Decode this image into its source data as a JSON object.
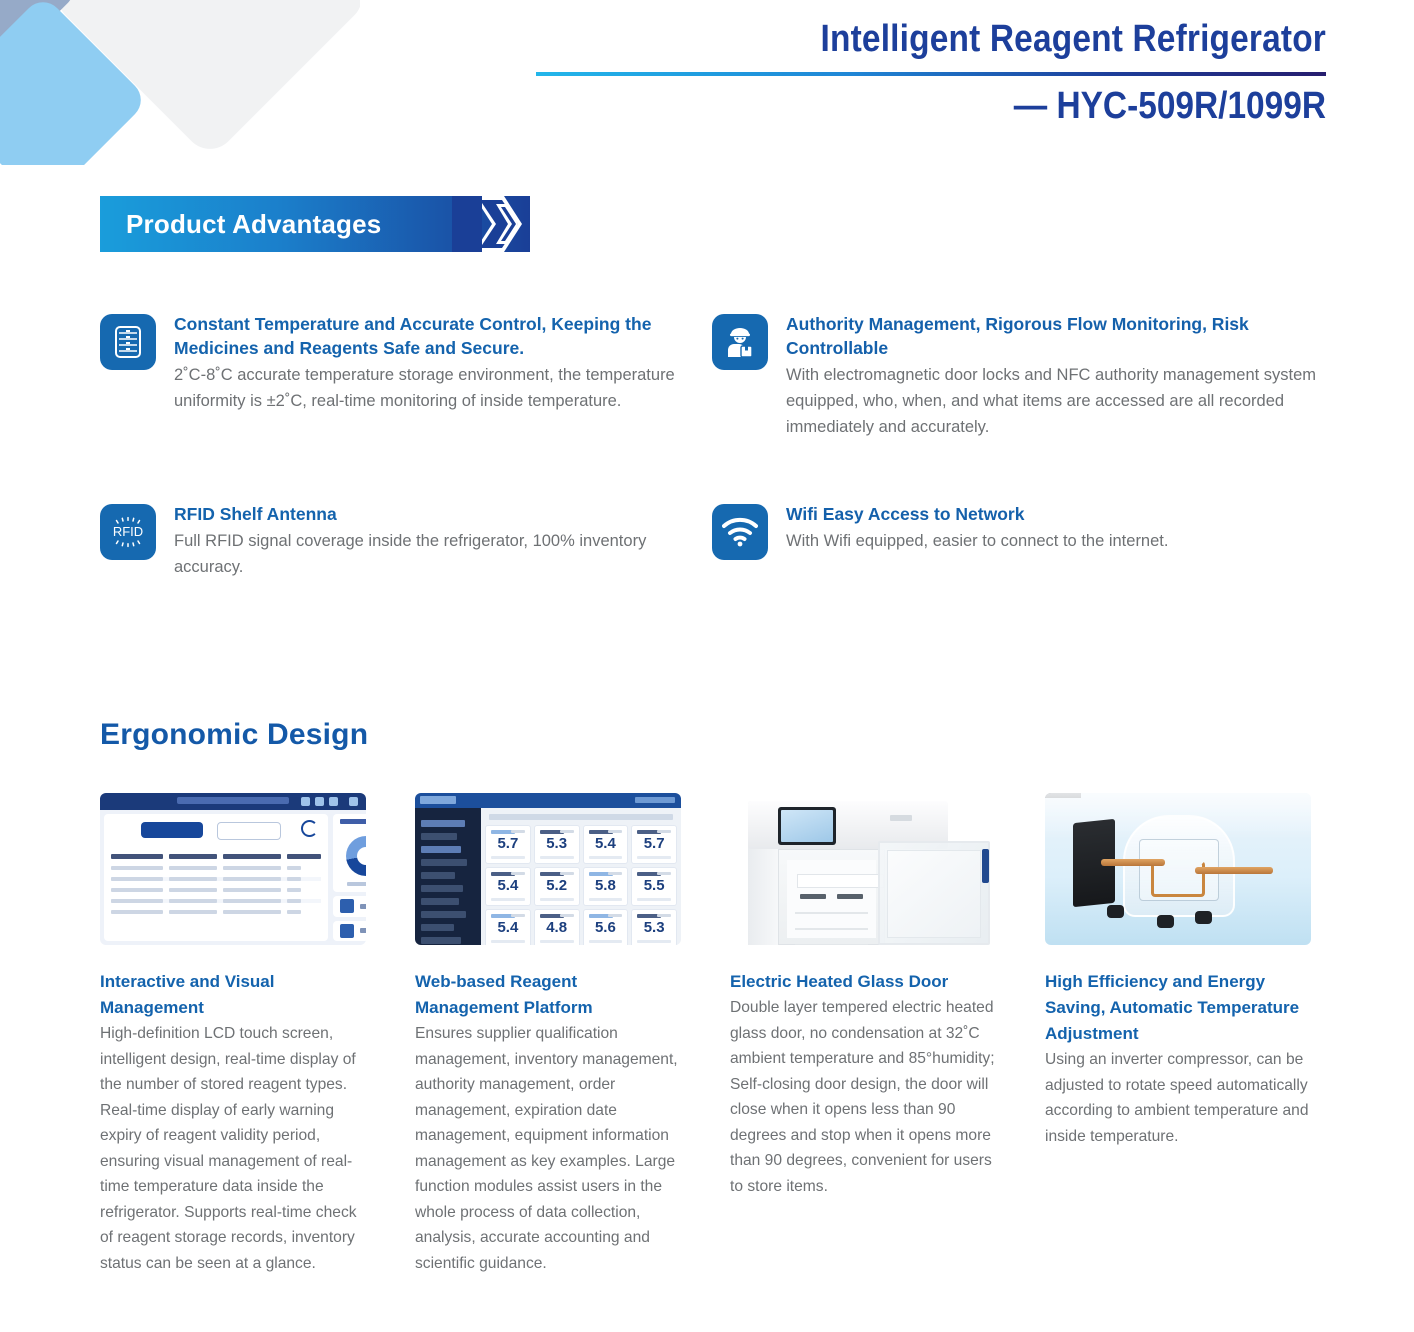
{
  "header": {
    "title": "Intelligent Reagent Refrigerator",
    "model": "— HYC-509R/1099R"
  },
  "banner": {
    "label": "Product Advantages",
    "chevron_icon": "chevron-right-icon",
    "gradient_from": "#1a9ddb",
    "gradient_to": "#1a3f97"
  },
  "features": [
    {
      "icon": "shelf-rack-icon",
      "title": "Constant Temperature and Accurate Control, Keeping the Medicines and Reagents Safe and Secure.",
      "desc": "2˚C-8˚C accurate temperature storage environment, the temperature uniformity is ±2˚C, real-time monitoring of inside temperature."
    },
    {
      "icon": "authority-person-badge-icon",
      "title": "Authority Management, Rigorous Flow Monitoring, Risk Controllable",
      "desc": "With electromagnetic door locks and NFC authority management system equipped, who, when, and what items are accessed are all recorded immediately and accurately."
    },
    {
      "icon": "rfid-icon",
      "title": "RFID Shelf Antenna",
      "desc": "Full RFID signal coverage inside the refrigerator, 100% inventory accuracy."
    },
    {
      "icon": "wifi-icon",
      "title": "Wifi Easy Access to Network",
      "desc": "With Wifi equipped, easier to connect to the internet."
    }
  ],
  "rfid_icon_label": "RFID",
  "ergonomic": {
    "section_title": "Ergonomic Design",
    "cards": [
      {
        "image_name": "lcd-touchscreen-ui-image",
        "title": "Interactive and Visual Management",
        "desc": "High-definition LCD touch screen, intelligent design, real-time display of the number of stored reagent types.\nReal-time display of early warning expiry of reagent validity period, ensuring visual management of real-time temperature data inside the refrigerator.\nSupports real-time check of reagent storage records, inventory status can be seen at a glance."
      },
      {
        "image_name": "web-platform-dashboard-image",
        "title": "Web-based Reagent Management Platform",
        "desc": "Ensures supplier qualification management, inventory management, authority management, order management, expiration date management, equipment information management as key examples.\nLarge function modules assist users in the whole process of data collection, analysis, accurate accounting and scientific guidance."
      },
      {
        "image_name": "refrigerator-glass-door-image",
        "title": "Electric Heated Glass Door",
        "desc": "Double layer tempered electric heated glass door, no condensation at 32˚C ambient temperature and 85°humidity;\nSelf-closing door design, the door will close when it opens less than 90 degrees and stop when it opens more than 90 degrees, convenient for users to store items."
      },
      {
        "image_name": "inverter-compressor-image",
        "title": "High Efficiency and Energy Saving, Automatic Temperature Adjustment",
        "desc": "Using an inverter compressor, can be adjusted to rotate speed automatically according to ambient temperature and inside temperature."
      }
    ]
  },
  "dashboard_readings": {
    "values": [
      "5.7",
      "5.3",
      "5.4",
      "5.7",
      "5.4",
      "5.2",
      "5.8",
      "5.5",
      "5.4",
      "4.8",
      "5.6",
      "5.3"
    ]
  },
  "colors": {
    "brand_navy": "#1d3f9b",
    "brand_blue": "#1463ad",
    "icon_blue": "#1669b0",
    "body_text": "#6e7174"
  }
}
